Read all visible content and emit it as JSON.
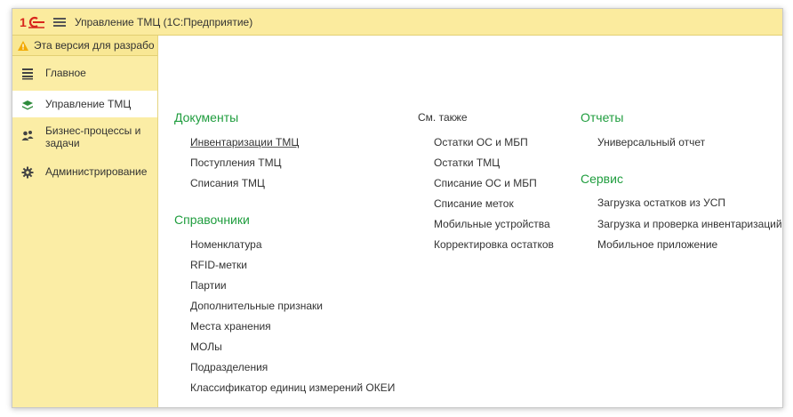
{
  "app": {
    "title": "Управление ТМЦ  (1С:Предприятие)",
    "logo_text": "1С"
  },
  "sidebar": {
    "warning": "Эта версия для разрабо",
    "items": [
      {
        "label": "Главное",
        "icon": "list-icon"
      },
      {
        "label": "Управление ТМЦ",
        "icon": "layers-icon",
        "active": true
      },
      {
        "label": "Бизнес-процессы и задачи",
        "icon": "users-icon"
      },
      {
        "label": "Администрирование",
        "icon": "gear-icon"
      }
    ]
  },
  "main": {
    "documents": {
      "title": "Документы",
      "items": [
        "Инвентаризации ТМЦ",
        "Поступления ТМЦ",
        "Списания ТМЦ"
      ]
    },
    "catalogs": {
      "title": "Справочники",
      "items": [
        "Номенклатура",
        "RFID-метки",
        "Партии",
        "Дополнительные признаки",
        "Места хранения",
        "МОЛы",
        "Подразделения",
        "Классификатор единиц измерений ОКЕИ"
      ]
    },
    "see_also": {
      "title": "См. также",
      "items": [
        "Остатки ОС и МБП",
        "Остатки ТМЦ",
        "Списание ОС и МБП",
        "Списание меток",
        "Мобильные устройства",
        "Корректировка остатков"
      ]
    },
    "reports": {
      "title": "Отчеты",
      "items": [
        "Универсальный отчет"
      ]
    },
    "service": {
      "title": "Сервис",
      "items": [
        "Загрузка остатков из УСП",
        "Загрузка и проверка инвентаризаций",
        "Мобильное приложение"
      ]
    }
  },
  "colors": {
    "titlebar": "#fbeb9e",
    "sidebar": "#fbeda5",
    "section_title": "#1f9d3e",
    "logo_red": "#d8261d"
  }
}
